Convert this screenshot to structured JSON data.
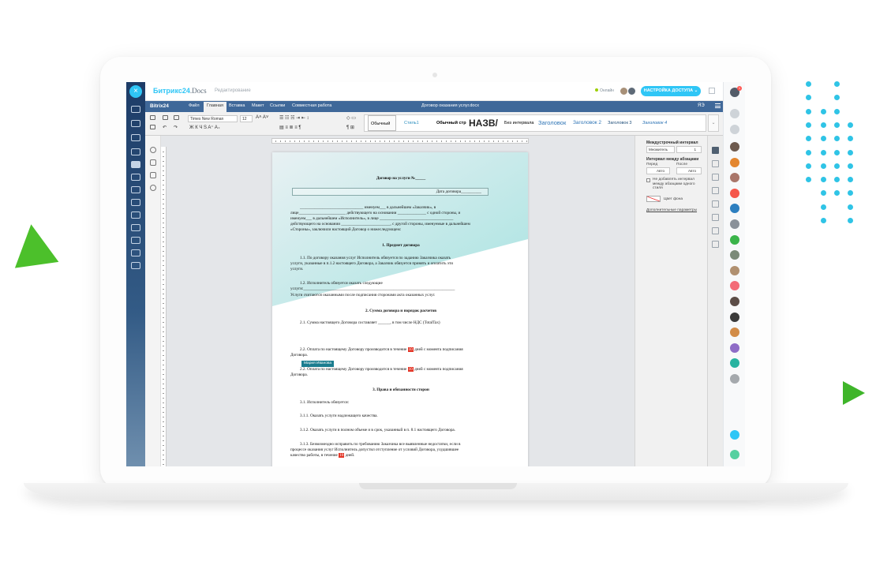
{
  "header": {
    "logo_brand": "Битрикс",
    "logo_num": "24",
    "logo_docs": "Docs",
    "edit_status": "Редактирование",
    "online_label": "Онлайн",
    "access_button": "НАСТРОЙКА ДОСТУПА ⌄"
  },
  "tabbar": {
    "brand": "Bitrix24",
    "tabs": [
      "Файл",
      "Главная",
      "Вставка",
      "Макет",
      "Ссылки",
      "Совместная работа"
    ],
    "active_tab": "Главная",
    "document_name": "Договор оказания услуг.docx",
    "user_initials": "ЯЭ"
  },
  "ribbon": {
    "font_name": "Times New Roman",
    "font_size": "12",
    "format_buttons": "Ж  К  Ч  S  A⁺  A₊",
    "styles": [
      "Обычный",
      "Стиль1",
      "Обычный стр",
      "НАЗВ/",
      "Без интервала",
      "Заголовок",
      "Заголовок 2",
      "Заголовок 3",
      "Заголовок 4"
    ]
  },
  "document": {
    "title": "Договор на услуги №_____",
    "date_field": "Дата договора__________",
    "preamble": [
      "_______________________________ именуем___ в дальнейшем «Заказчик», в",
      "лице_______________________ действующего на основании ______________ с одной стороны, и",
      "именуем___ в дальнейшем «Исполнитель», в лице ____________________________________",
      "действующего на основании ________________________, с другой стороны, именуемые в дальнейшем",
      "«Стороны», заключили настоящий Договор о нижеследующем:"
    ],
    "section1_title": "1. Предмет договора",
    "p1_1": [
      "1.1. По договору оказания услуг Исполнитель обязуется по заданию Заказчика оказать",
      "услуги, указанные в п.1.2 настоящего Договора, а Заказчик обязуется принять и оплатить эти",
      "услуги."
    ],
    "p1_2": [
      "1.2. Исполнитель обязуется оказать следующие",
      "услуги:__________________________________________________________________________",
      "Услуги считаются оказанными после подписания сторонами акта оказанных услуг."
    ],
    "section2_title": "2. Сумма договора и порядок расчетов",
    "p2_1": "2.1. Сумма настоящего Договора составляет ______, в том числе НДС (TotalTax)",
    "p2_2a": "2.2. Оплата по настоящему Договору производится в течение",
    "p2_2_days": "10",
    "p2_2b": "дней с момента подписания",
    "p2_2_end": "Договора.",
    "cursor_user": "Мария Иванова",
    "p2_2c_start": "2.2. Оплата по настоящему Договору производится в течение",
    "p2_2c_end": "дней с момента подписания",
    "p2_2c_last": "Договора.",
    "section3_title": "3. Права и обязанности сторон",
    "p3_1": "3.1. Исполнитель обязуется:",
    "p3_1_1": "3.1.1. Оказать услуги надлежащего качества.",
    "p3_1_2": "3.1.2. Оказать услуги в полном объеме и в срок, указанный в п. 8.1 настоящего Договора.",
    "p3_1_3": [
      "3.1.3. Безвозмездно исправить по требованию Заказчика все выявленные недостатки, если в",
      "процессе оказания услуг Исполнитель допустил отступление от условий Договора, ухудшившее",
      "качество работы, в течение"
    ],
    "p3_1_3_days": "10",
    "p3_1_3_end": "дней."
  },
  "right_panel": {
    "line_spacing_title": "Междустрочный интервал",
    "line_spacing_mode": "Множитель",
    "line_spacing_value": "1",
    "para_spacing_title": "Интервал между абзацами",
    "before_label": "Перед",
    "after_label": "После",
    "before_value": "Авто",
    "after_value": "Авто",
    "no_spacing_label": "Не добавлять интервал между абзацами одного стиля",
    "bg_color_label": "Цвет фона",
    "advanced_link": "Дополнительные параметры"
  },
  "colors": {
    "accent": "#2fc6f6",
    "tabbar": "#3f6899",
    "highlight": "#e33526",
    "green": "#3fb52a"
  }
}
